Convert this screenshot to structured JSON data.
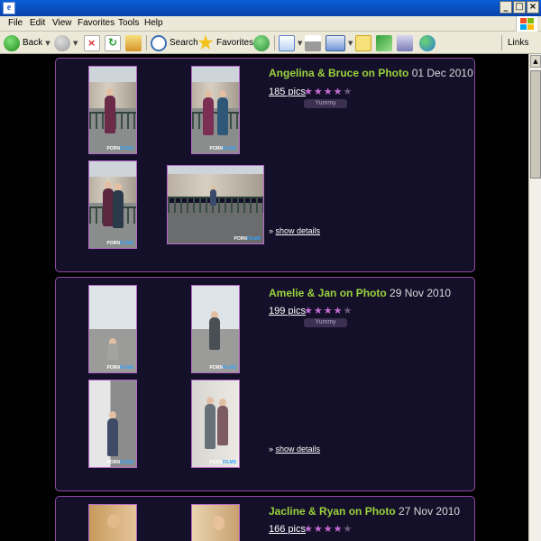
{
  "window": {
    "menu": [
      "File",
      "Edit",
      "View",
      "Favorites",
      "Tools",
      "Help"
    ]
  },
  "toolbar": {
    "back_label": "Back",
    "search_label": "Search",
    "favorites_label": "Favorites",
    "links_label": "Links"
  },
  "colors": {
    "title_green": "#9ad23c",
    "card_border": "#8e4aa3",
    "card_bg": "#15102a",
    "star_on": "#c36cd2"
  },
  "galleries": [
    {
      "title": "Angelina & Bruce on Photo",
      "date": "01 Dec 2010",
      "pics": "185 pics",
      "rating": 4,
      "tag": "Yummy",
      "details": "show details",
      "watermark_a": "PORN",
      "watermark_b": "FILMS"
    },
    {
      "title": "Amelie & Jan on Photo",
      "date": "29 Nov 2010",
      "pics": "199 pics",
      "rating": 4,
      "tag": "Yummy",
      "details": "show details",
      "watermark_a": "PORN",
      "watermark_b": "FILMS"
    },
    {
      "title": "Jacline & Ryan on Photo",
      "date": "27 Nov 2010",
      "pics": "166 pics",
      "rating": 4,
      "tag": "",
      "details": "",
      "watermark_a": "",
      "watermark_b": ""
    }
  ]
}
